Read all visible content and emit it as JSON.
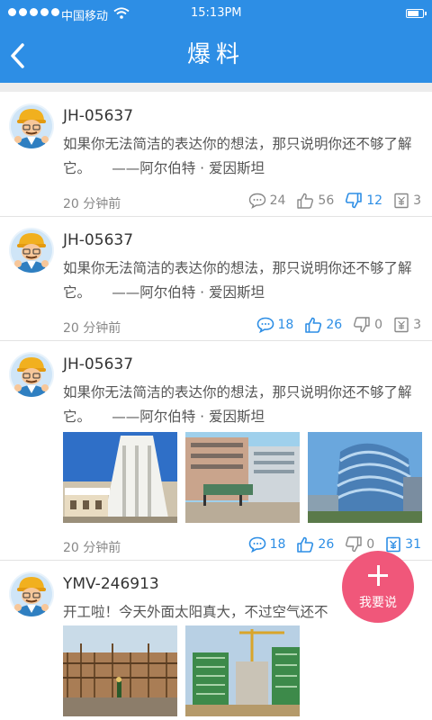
{
  "status_bar": {
    "carrier": "中国移动",
    "time": "15:13PM"
  },
  "header": {
    "title": "爆料"
  },
  "posts": [
    {
      "username": "JH-05637",
      "text": "如果你无法简洁的表达你的想法，那只说明你还不够了解它。　　——阿尔伯特 · 爱因斯坦",
      "time": "20 分钟前",
      "comments": "24",
      "likes": "56",
      "dislikes": "12",
      "rewards": "3"
    },
    {
      "username": "JH-05637",
      "text": "如果你无法简洁的表达你的想法，那只说明你还不够了解它。　　——阿尔伯特 · 爱因斯坦",
      "time": "20 分钟前",
      "comments": "18",
      "likes": "26",
      "dislikes": "0",
      "rewards": "3"
    },
    {
      "username": "JH-05637",
      "text": "如果你无法简洁的表达你的想法，那只说明你还不够了解它。　　——阿尔伯特 · 爱因斯坦",
      "time": "20 分钟前",
      "comments": "18",
      "likes": "26",
      "dislikes": "0",
      "rewards": "31"
    },
    {
      "username": "YMV-246913",
      "text": "开工啦！今天外面太阳真大，不过空气还不"
    }
  ],
  "fab": {
    "label": "我要说"
  },
  "colors": {
    "primary": "#2d8ee5",
    "fab": "#f0577a",
    "muted": "#888888"
  }
}
